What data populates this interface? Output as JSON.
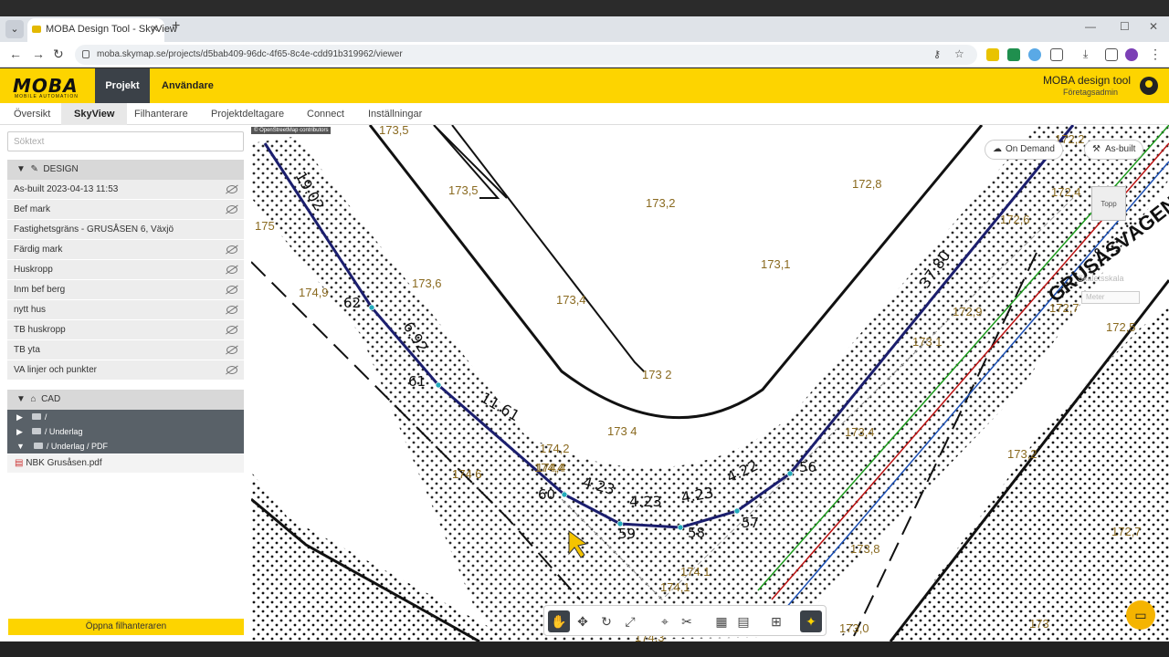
{
  "browser": {
    "tab_title": "MOBA Design Tool - SkyView",
    "url": "moba.skymap.se/projects/d5bab409-96dc-4f65-8c4e-cdd91b319962/viewer"
  },
  "header": {
    "logo_text": "MOBA",
    "logo_sub": "MOBILE AUTOMATION",
    "nav": [
      "Projekt",
      "Användare"
    ],
    "app_title": "MOBA design tool",
    "app_subtitle": "Företagsadmin"
  },
  "subnav": [
    "Översikt",
    "SkyView",
    "Filhanterare",
    "Projektdeltagare",
    "Connect",
    "Inställningar"
  ],
  "sidebar": {
    "search_placeholder": "Söktext",
    "design_header": "DESIGN",
    "layers": [
      "As-built 2023-04-13 11:53",
      "Bef mark",
      "Fastighetsgräns - GRUSÅSEN 6, Växjö",
      "Färdig mark",
      "Huskropp",
      "Inm bef berg",
      "nytt hus",
      "TB huskropp",
      "TB yta",
      "VA linjer och punkter"
    ],
    "cad_header": "CAD",
    "folders": [
      "/",
      "/ Underlag",
      "/ Underlag / PDF"
    ],
    "pdf_file": "NBK Grusåsen.pdf",
    "open_button": "Öppna filhanteraren"
  },
  "map": {
    "osm_credit": "© OpenStreetMap contributors",
    "on_demand": "On Demand",
    "as_built": "As-built",
    "topp": "Topp",
    "scale_label": "Skaletsskala",
    "scale_unit": "Meter",
    "street_name": "GRUSÅSVÄGEN",
    "elevations": [
      "173,5",
      "173,5",
      "173,2",
      "172,8",
      "175",
      "174,9",
      "173,6",
      "173,4",
      "172,4",
      "172,6",
      "173,1",
      "172,9",
      "172,7",
      "172,5",
      "173 2",
      "173 1",
      "174 6",
      "174,2",
      "174,4",
      "173 4",
      "173,4",
      "173,2",
      "174 6",
      "174,4",
      "174 1",
      "174,1",
      "173,8",
      "172,7",
      "174,3",
      "173,0",
      "173",
      "172,2"
    ],
    "dimensions": [
      "19.02",
      "6.92",
      "11.61",
      "4.23",
      "4.23",
      "4.23",
      "4.22",
      "37.80"
    ],
    "points": [
      "62",
      "61",
      "60",
      "59",
      "58",
      "57",
      "56"
    ]
  },
  "colors": {
    "brand_yellow": "#fdd400",
    "dark": "#3b4148",
    "survey_line": "#1b1e6e"
  },
  "icons": [
    "pan-icon",
    "move-icon",
    "rotate-icon",
    "fit-icon",
    "pin-icon",
    "ruler-icon",
    "calculator-icon",
    "document-icon",
    "map-icon",
    "lightbulb-icon"
  ]
}
